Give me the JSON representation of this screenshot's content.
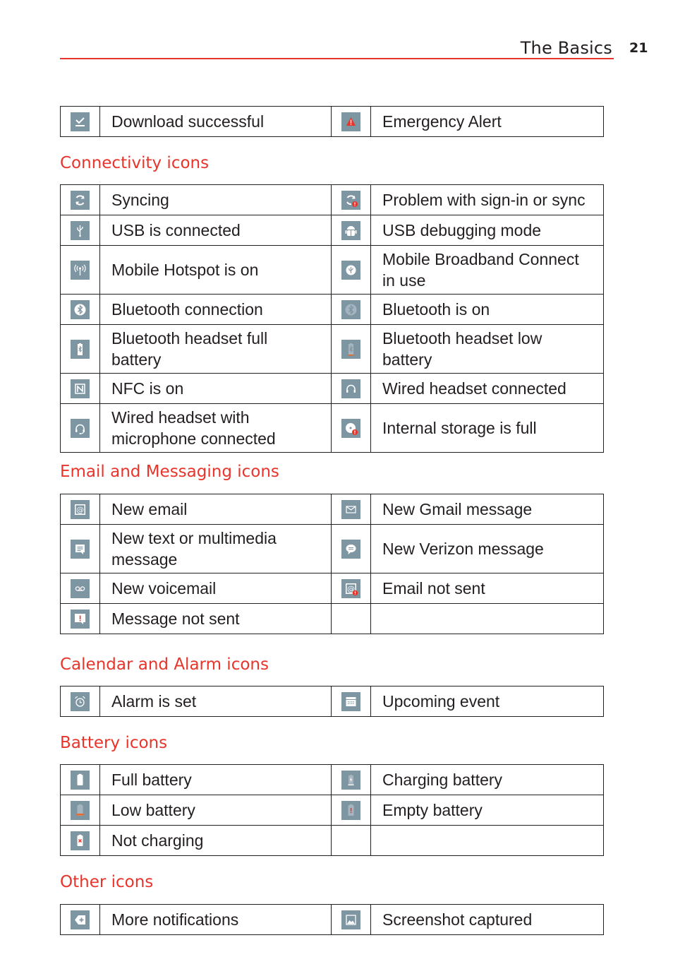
{
  "header": {
    "title": "The Basics",
    "page_number": "21"
  },
  "colors": {
    "accent": "#e8342b",
    "icon_bg": "#7e95a2",
    "alert_red": "#e8342b",
    "text": "#231f20"
  },
  "sections": [
    {
      "title": "",
      "rows": [
        [
          {
            "icon": "download-icon",
            "label": "Download successful"
          },
          {
            "icon": "emergency-alert-icon",
            "label": "Emergency Alert"
          }
        ]
      ]
    },
    {
      "title": "Connectivity icons",
      "rows": [
        [
          {
            "icon": "sync-icon",
            "label": "Syncing"
          },
          {
            "icon": "sync-problem-icon",
            "label": "Problem with sign-in or sync"
          }
        ],
        [
          {
            "icon": "usb-icon",
            "label": "USB is connected"
          },
          {
            "icon": "usb-debug-icon",
            "label": "USB debugging mode"
          }
        ],
        [
          {
            "icon": "hotspot-icon",
            "label": "Mobile Hotspot is on"
          },
          {
            "icon": "broadband-icon",
            "label": "Mobile Broadband Connect in use"
          }
        ],
        [
          {
            "icon": "bluetooth-connected-icon",
            "label": "Bluetooth connection"
          },
          {
            "icon": "bluetooth-on-icon",
            "label": "Bluetooth is on"
          }
        ],
        [
          {
            "icon": "bt-headset-full-battery-icon",
            "label": "Bluetooth headset full battery"
          },
          {
            "icon": "bt-headset-low-battery-icon",
            "label": "Bluetooth headset low battery"
          }
        ],
        [
          {
            "icon": "nfc-icon",
            "label": "NFC is on"
          },
          {
            "icon": "headset-icon",
            "label": "Wired headset connected"
          }
        ],
        [
          {
            "icon": "headset-mic-icon",
            "label": "Wired headset with microphone connected"
          },
          {
            "icon": "storage-full-icon",
            "label": "Internal storage is full"
          }
        ]
      ]
    },
    {
      "title": "Email and Messaging icons",
      "rows": [
        [
          {
            "icon": "email-icon",
            "label": "New email"
          },
          {
            "icon": "gmail-icon",
            "label": "New Gmail message"
          }
        ],
        [
          {
            "icon": "message-icon",
            "label": "New text or multimedia message"
          },
          {
            "icon": "verizon-message-icon",
            "label": "New Verizon message"
          }
        ],
        [
          {
            "icon": "voicemail-icon",
            "label": "New voicemail"
          },
          {
            "icon": "email-error-icon",
            "label": "Email not sent"
          }
        ],
        [
          {
            "icon": "message-error-icon",
            "label": "Message not sent"
          },
          {
            "icon": "",
            "label": ""
          }
        ]
      ]
    },
    {
      "title": "Calendar and Alarm icons",
      "rows": [
        [
          {
            "icon": "alarm-icon",
            "label": "Alarm is set"
          },
          {
            "icon": "calendar-icon",
            "label": "Upcoming event"
          }
        ]
      ]
    },
    {
      "title": "Battery icons",
      "rows": [
        [
          {
            "icon": "battery-full-icon",
            "label": "Full battery"
          },
          {
            "icon": "battery-charging-icon",
            "label": "Charging battery"
          }
        ],
        [
          {
            "icon": "battery-low-icon",
            "label": "Low battery"
          },
          {
            "icon": "battery-empty-icon",
            "label": "Empty battery"
          }
        ],
        [
          {
            "icon": "battery-not-charging-icon",
            "label": "Not charging"
          },
          {
            "icon": "",
            "label": ""
          }
        ]
      ]
    },
    {
      "title": "Other icons",
      "rows": [
        [
          {
            "icon": "more-notifications-icon",
            "label": "More notifications"
          },
          {
            "icon": "screenshot-icon",
            "label": "Screenshot captured"
          }
        ]
      ]
    }
  ]
}
